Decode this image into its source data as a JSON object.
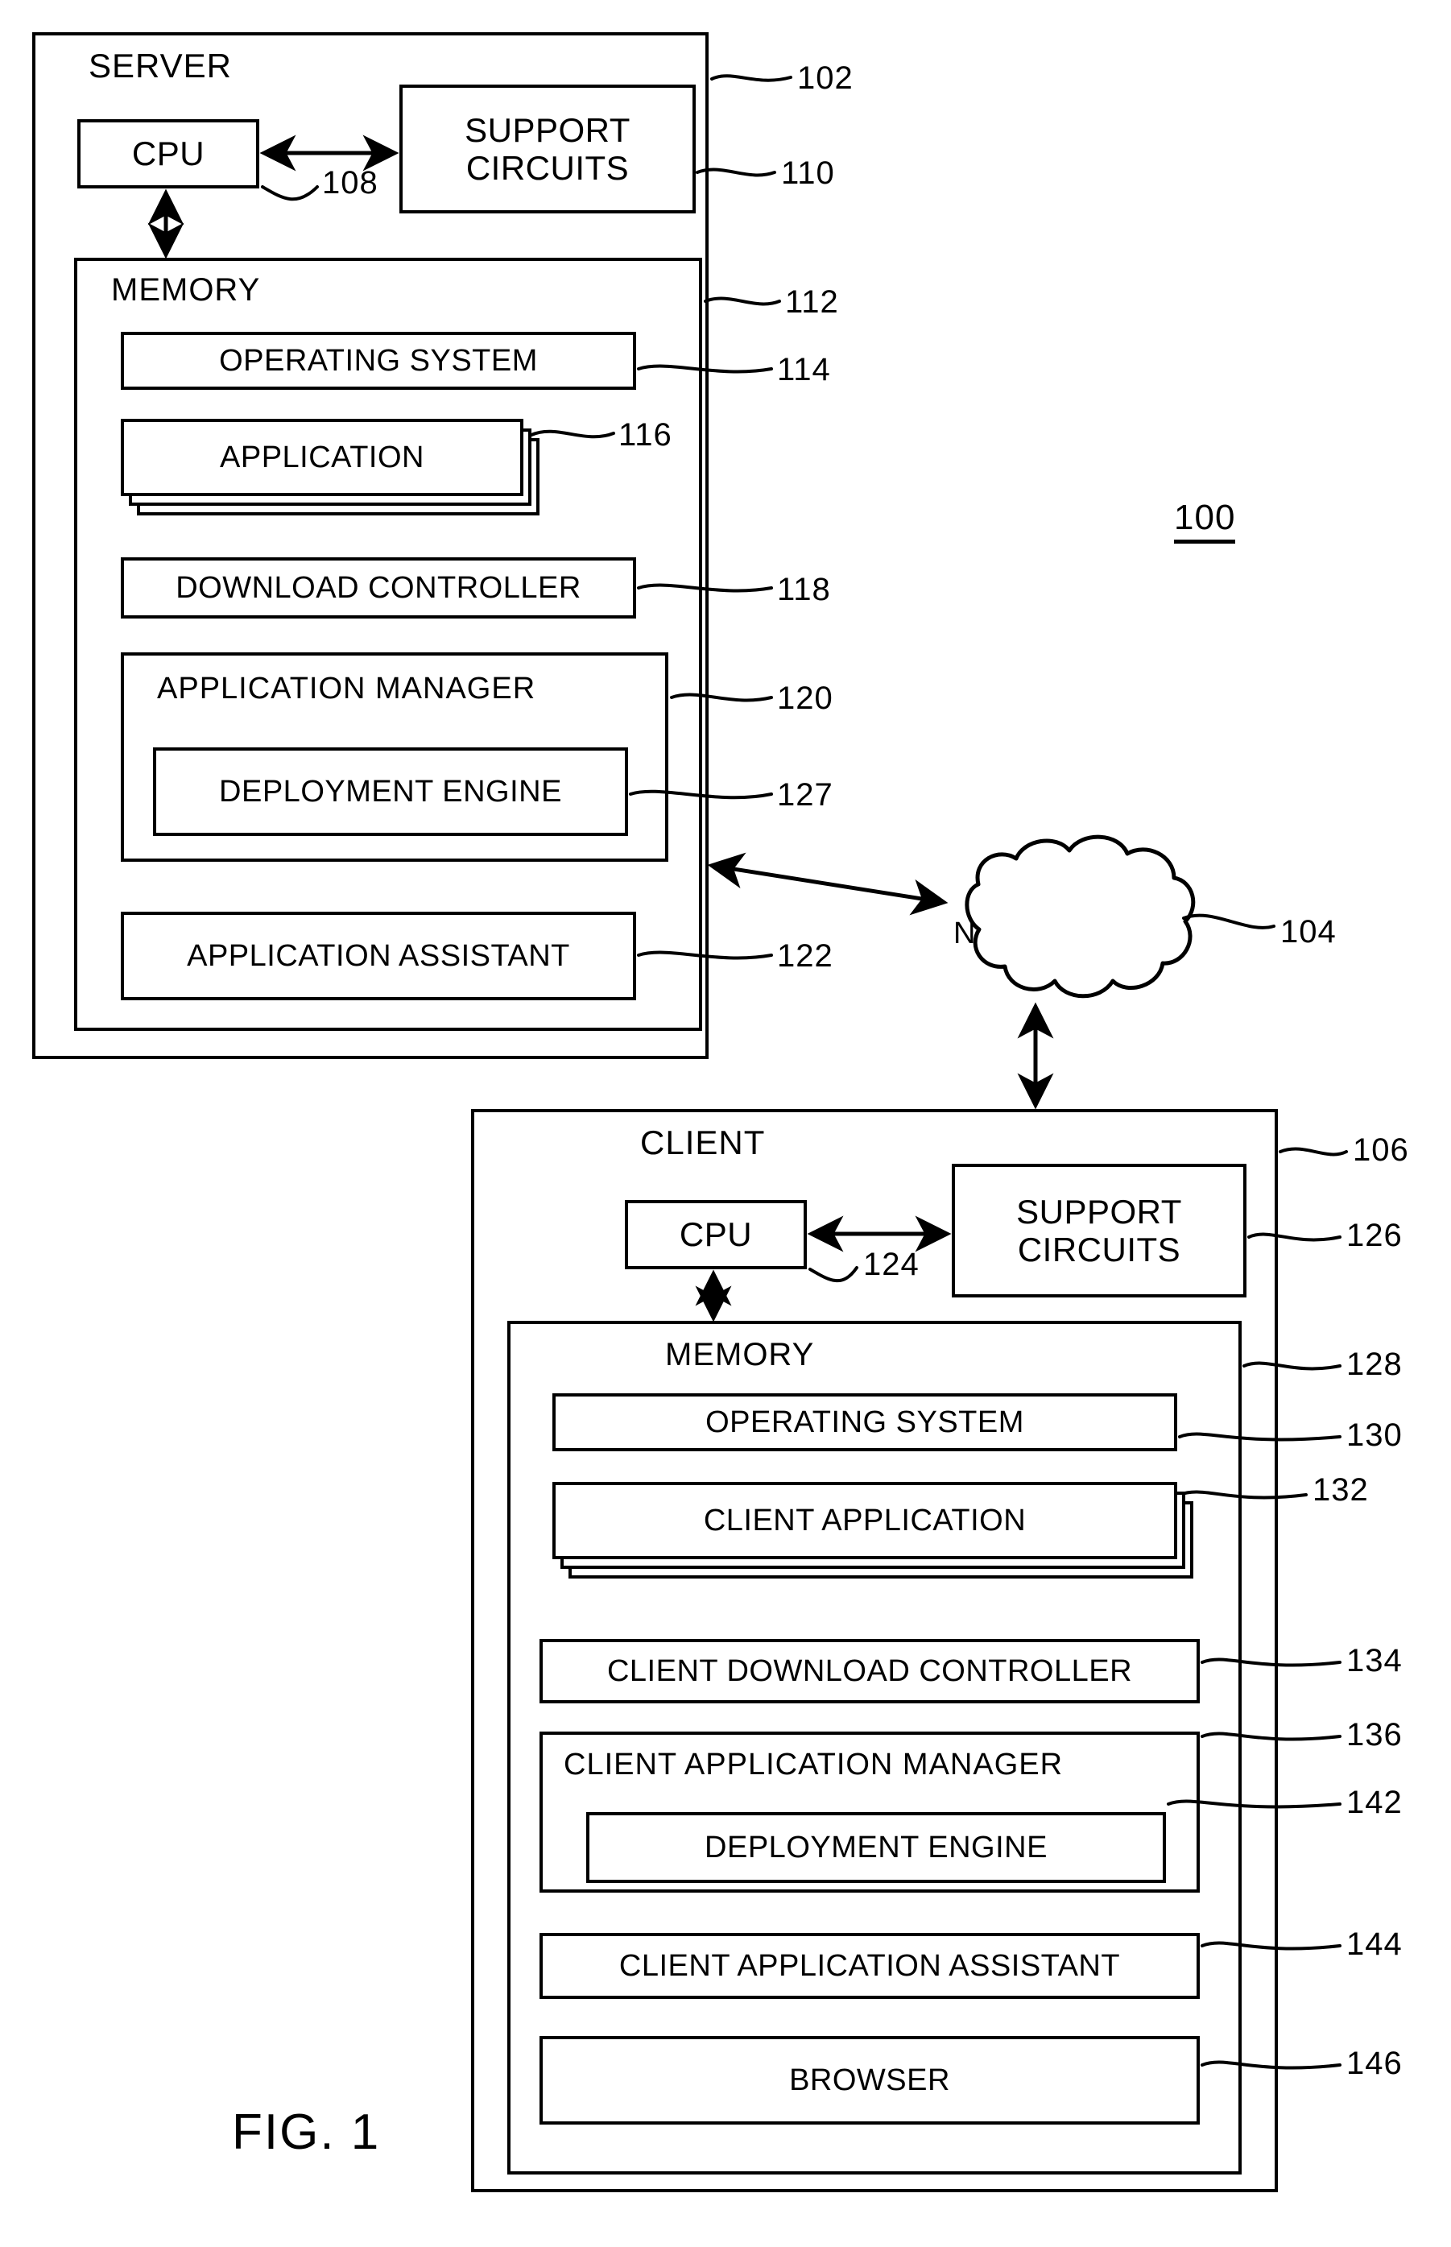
{
  "figure": {
    "caption": "FIG. 1",
    "system_ref": "100"
  },
  "server": {
    "title": "SERVER",
    "ref": "102",
    "cpu": {
      "label": "CPU",
      "ref": "108"
    },
    "support_circuits": {
      "label_line1": "SUPPORT",
      "label_line2": "CIRCUITS",
      "ref": "110"
    },
    "memory": {
      "title": "MEMORY",
      "ref": "112",
      "items": [
        {
          "label": "OPERATING SYSTEM",
          "ref": "114"
        },
        {
          "label": "APPLICATION",
          "ref": "116"
        },
        {
          "label": "DOWNLOAD CONTROLLER",
          "ref": "118"
        },
        {
          "label": "APPLICATION MANAGER",
          "ref": "120"
        },
        {
          "label": "DEPLOYMENT ENGINE",
          "ref": "127"
        },
        {
          "label": "APPLICATION ASSISTANT",
          "ref": "122"
        }
      ]
    }
  },
  "network": {
    "label": "NETWORK",
    "ref": "104"
  },
  "client": {
    "title": "CLIENT",
    "ref": "106",
    "cpu": {
      "label": "CPU",
      "ref": "124"
    },
    "support_circuits": {
      "label_line1": "SUPPORT",
      "label_line2": "CIRCUITS",
      "ref": "126"
    },
    "memory": {
      "title": "MEMORY",
      "ref": "128",
      "items": [
        {
          "label": "OPERATING SYSTEM",
          "ref": "130"
        },
        {
          "label": "CLIENT APPLICATION",
          "ref": "132"
        },
        {
          "label": "CLIENT DOWNLOAD CONTROLLER",
          "ref": "134"
        },
        {
          "label": "CLIENT APPLICATION MANAGER",
          "ref": "136"
        },
        {
          "label": "DEPLOYMENT ENGINE",
          "ref": "142"
        },
        {
          "label": "CLIENT APPLICATION ASSISTANT",
          "ref": "144"
        },
        {
          "label": "BROWSER",
          "ref": "146"
        }
      ]
    }
  },
  "colors": {
    "ink": "#000000",
    "paper": "#ffffff"
  }
}
